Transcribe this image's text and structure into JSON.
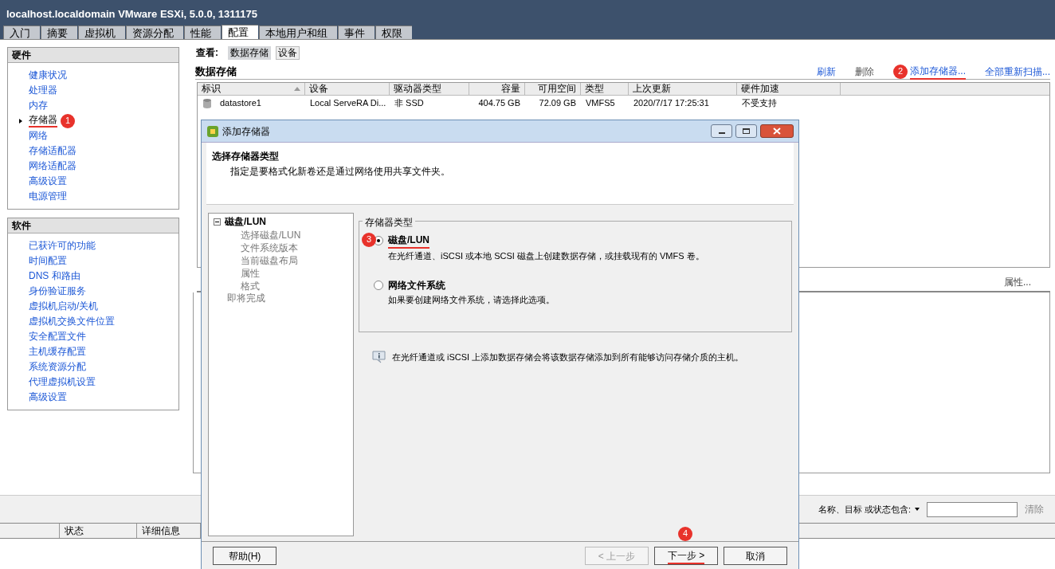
{
  "window": {
    "title": "localhost.localdomain VMware ESXi, 5.0.0, 1311175"
  },
  "tabs": [
    {
      "label": "入门",
      "selected": false
    },
    {
      "label": "摘要",
      "selected": false
    },
    {
      "label": "虚拟机",
      "selected": false
    },
    {
      "label": "资源分配",
      "selected": false
    },
    {
      "label": "性能",
      "selected": false
    },
    {
      "label": "配置",
      "selected": true
    },
    {
      "label": "本地用户和组",
      "selected": false
    },
    {
      "label": "事件",
      "selected": false
    },
    {
      "label": "权限",
      "selected": false
    }
  ],
  "sidebar": {
    "sections": [
      {
        "title": "硬件",
        "items": [
          {
            "label": "健康状况",
            "selected": false
          },
          {
            "label": "处理器",
            "selected": false
          },
          {
            "label": "内存",
            "selected": false
          },
          {
            "label": "存储器",
            "selected": true,
            "badge": "1"
          },
          {
            "label": "网络",
            "selected": false
          },
          {
            "label": "存储适配器",
            "selected": false
          },
          {
            "label": "网络适配器",
            "selected": false
          },
          {
            "label": "高级设置",
            "selected": false
          },
          {
            "label": "电源管理",
            "selected": false
          }
        ]
      },
      {
        "title": "软件",
        "items": [
          {
            "label": "已获许可的功能",
            "selected": false
          },
          {
            "label": "时间配置",
            "selected": false
          },
          {
            "label": "DNS 和路由",
            "selected": false
          },
          {
            "label": "身份验证服务",
            "selected": false
          },
          {
            "label": "虚拟机启动/关机",
            "selected": false
          },
          {
            "label": "虚拟机交换文件位置",
            "selected": false
          },
          {
            "label": "安全配置文件",
            "selected": false
          },
          {
            "label": "主机缓存配置",
            "selected": false
          },
          {
            "label": "系统资源分配",
            "selected": false
          },
          {
            "label": "代理虚拟机设置",
            "selected": false
          },
          {
            "label": "高级设置",
            "selected": false
          }
        ]
      }
    ]
  },
  "view": {
    "label": "查看:",
    "options": [
      {
        "label": "数据存储",
        "selected": true
      },
      {
        "label": "设备",
        "selected": false
      }
    ]
  },
  "datastores": {
    "title": "数据存储",
    "actions": [
      {
        "label": "刷新",
        "disabled": false
      },
      {
        "label": "删除",
        "disabled": true
      },
      {
        "label": "添加存储器...",
        "disabled": false,
        "badge": "2"
      },
      {
        "label": "全部重新扫描...",
        "disabled": false
      }
    ],
    "columns": [
      {
        "label": "标识",
        "kind": "text",
        "sorted": true
      },
      {
        "label": "设备",
        "kind": "text",
        "sorted": false
      },
      {
        "label": "驱动器类型",
        "kind": "text",
        "sorted": false
      },
      {
        "label": "容量",
        "kind": "number",
        "sorted": false
      },
      {
        "label": "可用空间",
        "kind": "number",
        "sorted": false
      },
      {
        "label": "类型",
        "kind": "text",
        "sorted": false
      },
      {
        "label": "上次更新",
        "kind": "text",
        "sorted": false
      },
      {
        "label": "硬件加速",
        "kind": "text",
        "sorted": false
      }
    ],
    "rows": [
      [
        "datastore1",
        "Local ServeRA Di...",
        "非 SSD",
        "404.75 GB",
        "72.09 GB",
        "VMFS5",
        "2020/7/17 17:25:31",
        "不受支持"
      ]
    ]
  },
  "details": {
    "action": "属性..."
  },
  "filter": {
    "label": "名称、目标 或状态包含:",
    "clear": "清除"
  },
  "tasks": {
    "columns": [
      "状态",
      "详细信息"
    ]
  },
  "dialog": {
    "title": "添加存储器",
    "heading": "选择存储器类型",
    "subheading": "指定是要格式化新卷还是通过网络使用共享文件夹。",
    "steps": [
      {
        "label": "磁盘/LUN",
        "active": true,
        "expanded": true,
        "children": [
          {
            "label": "选择磁盘/LUN",
            "active": false
          },
          {
            "label": "文件系统版本",
            "active": false
          },
          {
            "label": "当前磁盘布局",
            "active": false
          },
          {
            "label": "属性",
            "active": false
          },
          {
            "label": "格式",
            "active": false
          }
        ]
      },
      {
        "label": "即将完成",
        "active": false
      }
    ],
    "group_title": "存储器类型",
    "options": [
      {
        "label": "磁盘/LUN",
        "description": "在光纤通道、iSCSI 或本地 SCSI 磁盘上创建数据存储，或挂载现有的 VMFS 卷。",
        "selected": true,
        "badge": "3"
      },
      {
        "label": "网络文件系统",
        "description": "如果要创建网络文件系统，请选择此选项。",
        "selected": false
      }
    ],
    "note": "在光纤通道或 iSCSI 上添加数据存储会将该数据存储添加到所有能够访问存储介质的主机。",
    "buttons": [
      {
        "label": "帮助(H)",
        "kind": "help",
        "disabled": false
      },
      {
        "label": "< 上一步",
        "kind": "nav",
        "disabled": true
      },
      {
        "label": "下一步 >",
        "kind": "nav",
        "disabled": false,
        "badge": "4"
      },
      {
        "label": "取消",
        "kind": "nav",
        "disabled": false
      }
    ]
  }
}
